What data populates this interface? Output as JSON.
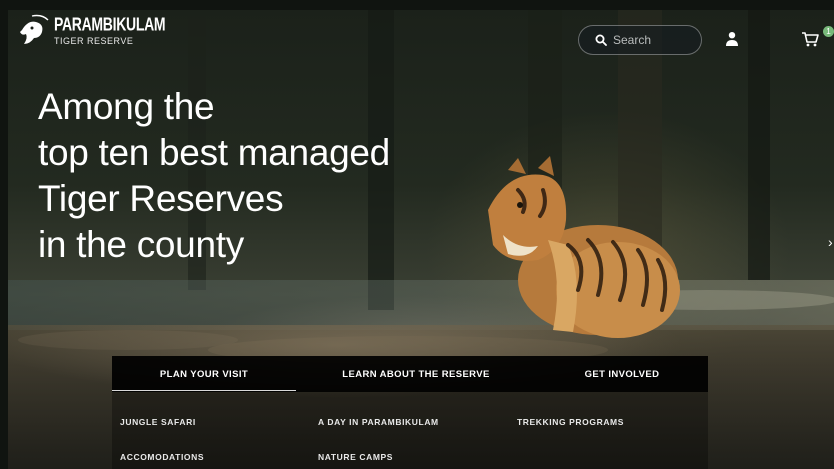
{
  "brand": {
    "title": "PARAMBIKULAM",
    "subtitle": "TIGER RESERVE"
  },
  "header": {
    "search_placeholder": "Search",
    "cart_count": "1",
    "icons": [
      "search-icon",
      "user-icon",
      "cart-icon"
    ]
  },
  "hero": {
    "headline_lines": [
      "Among the",
      "top ten best managed",
      "Tiger Reserves",
      "in the county"
    ]
  },
  "nav": {
    "tabs": [
      {
        "label": "PLAN YOUR VISIT",
        "active": true
      },
      {
        "label": "LEARN ABOUT THE RESERVE",
        "active": false
      },
      {
        "label": "GET INVOLVED",
        "active": false
      }
    ],
    "links": [
      "JUNGLE SAFARI",
      "A DAY IN PARAMBIKULAM",
      "TREKKING PROGRAMS",
      "ACCOMODATIONS",
      "NATURE CAMPS"
    ]
  },
  "colors": {
    "badge": "#78b87a",
    "nav_bg": "#000000",
    "text": "#ffffff"
  }
}
